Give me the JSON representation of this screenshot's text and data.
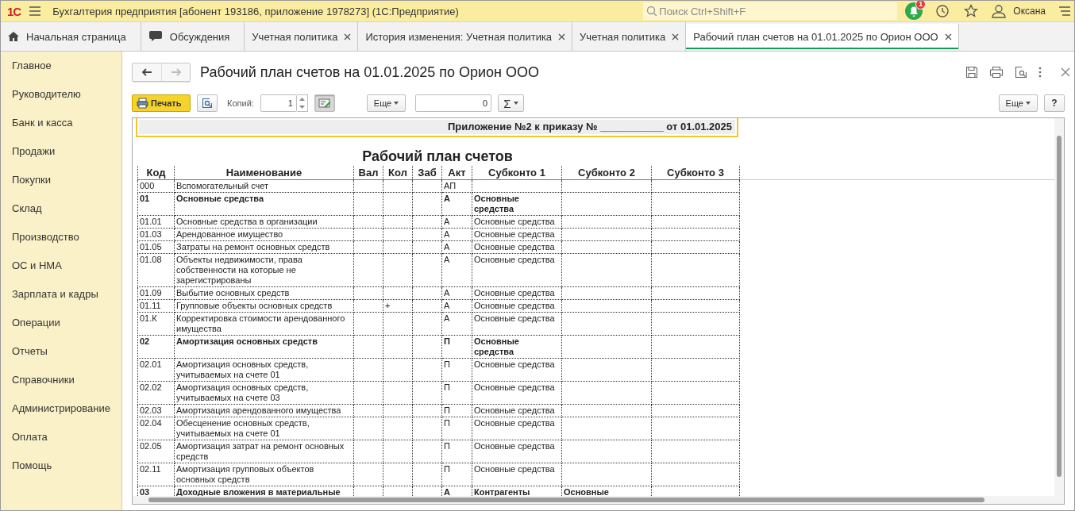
{
  "topbar": {
    "logo": "1С",
    "title": "Бухгалтерия предприятия [абонент 193186, приложение 1978273]  (1С:Предприятие)",
    "search_placeholder": "Поиск Ctrl+Shift+F",
    "notifications": "1",
    "user": "Оксана"
  },
  "tabs": [
    {
      "kind": "home",
      "label": "Начальная страница",
      "selected": false
    },
    {
      "kind": "discussions",
      "label": "Обсуждения",
      "selected": false
    },
    {
      "kind": "document",
      "label": "Учетная политика",
      "selected": false
    },
    {
      "kind": "document",
      "label": "История изменения: Учетная политика",
      "selected": false
    },
    {
      "kind": "document",
      "label": "Учетная политика",
      "selected": false
    },
    {
      "kind": "document",
      "label": "Рабочий план счетов на 01.01.2025 по Орион ООО",
      "selected": true
    }
  ],
  "sidebar": {
    "items": [
      "Главное",
      "Руководителю",
      "Банк и касса",
      "Продажи",
      "Покупки",
      "Склад",
      "Производство",
      "ОС и НМА",
      "Зарплата и кадры",
      "Операции",
      "Отчеты",
      "Справочники",
      "Администрирование",
      "Оплата",
      "Помощь"
    ]
  },
  "form": {
    "title": "Рабочий план счетов на 01.01.2025 по Орион ООО"
  },
  "toolbar": {
    "print": "Печать",
    "copies_label": "Копий:",
    "copies": "1",
    "edit_toggle_pressed": true,
    "more": "Еще",
    "sum_value": "0",
    "sum": "Σ",
    "more_right": "Еще",
    "help": "?"
  },
  "report": {
    "appendix": "Приложение №2 к приказу № ___________ от 01.01.2025",
    "title": "Рабочий план счетов",
    "columns": [
      "Код",
      "Наименование",
      "Вал",
      "Кол",
      "Заб",
      "Акт",
      "Субконто 1",
      "Субконто 2",
      "Субконто 3"
    ],
    "rows": [
      {
        "bold": false,
        "cells": [
          "000",
          "Вспомогательный счет",
          "",
          "",
          "",
          "АП",
          "",
          "",
          ""
        ]
      },
      {
        "bold": true,
        "cells": [
          "01",
          "Основные средства",
          "",
          "",
          "",
          "А",
          "Основные средства",
          "",
          ""
        ]
      },
      {
        "bold": false,
        "cells": [
          "01.01",
          "Основные средства в организации",
          "",
          "",
          "",
          "А",
          "Основные средства",
          "",
          ""
        ]
      },
      {
        "bold": false,
        "cells": [
          "01.03",
          "Арендованное имущество",
          "",
          "",
          "",
          "А",
          "Основные средства",
          "",
          ""
        ]
      },
      {
        "bold": false,
        "cells": [
          "01.05",
          "Затраты на ремонт основных средств",
          "",
          "",
          "",
          "А",
          "Основные средства",
          "",
          ""
        ]
      },
      {
        "bold": false,
        "cells": [
          "01.08",
          "Объекты недвижимости, права собственности на которые не зарегистрированы",
          "",
          "",
          "",
          "А",
          "Основные средства",
          "",
          ""
        ]
      },
      {
        "bold": false,
        "cells": [
          "01.09",
          "Выбытие основных средств",
          "",
          "",
          "",
          "А",
          "Основные средства",
          "",
          ""
        ]
      },
      {
        "bold": false,
        "cells": [
          "01.11",
          "Групповые объекты основных средств",
          "",
          "+",
          "",
          "А",
          "Основные средства",
          "",
          ""
        ]
      },
      {
        "bold": false,
        "cells": [
          "01.К",
          "Корректировка стоимости арендованного имущества",
          "",
          "",
          "",
          "А",
          "Основные средства",
          "",
          ""
        ]
      },
      {
        "bold": true,
        "cells": [
          "02",
          "Амортизация основных средств",
          "",
          "",
          "",
          "П",
          "Основные средства",
          "",
          ""
        ]
      },
      {
        "bold": false,
        "cells": [
          "02.01",
          "Амортизация основных средств, учитываемых на счете 01",
          "",
          "",
          "",
          "П",
          "Основные средства",
          "",
          ""
        ]
      },
      {
        "bold": false,
        "cells": [
          "02.02",
          "Амортизация основных средств, учитываемых на счете 03",
          "",
          "",
          "",
          "П",
          "Основные средства",
          "",
          ""
        ]
      },
      {
        "bold": false,
        "cells": [
          "02.03",
          "Амортизация арендованного имущества",
          "",
          "",
          "",
          "П",
          "Основные средства",
          "",
          ""
        ]
      },
      {
        "bold": false,
        "cells": [
          "02.04",
          "Обесценение основных средств, учитываемых на счете 01",
          "",
          "",
          "",
          "П",
          "Основные средства",
          "",
          ""
        ]
      },
      {
        "bold": false,
        "cells": [
          "02.05",
          "Амортизация затрат на ремонт основных средств",
          "",
          "",
          "",
          "П",
          "Основные средства",
          "",
          ""
        ]
      },
      {
        "bold": false,
        "cells": [
          "02.11",
          "Амортизация групповых объектов основных средств",
          "",
          "",
          "",
          "П",
          "Основные средства",
          "",
          ""
        ]
      },
      {
        "bold": true,
        "cells": [
          "03",
          "Доходные вложения в материальные",
          "",
          "",
          "",
          "А",
          "Контрагенты",
          "Основные",
          ""
        ]
      }
    ]
  }
}
